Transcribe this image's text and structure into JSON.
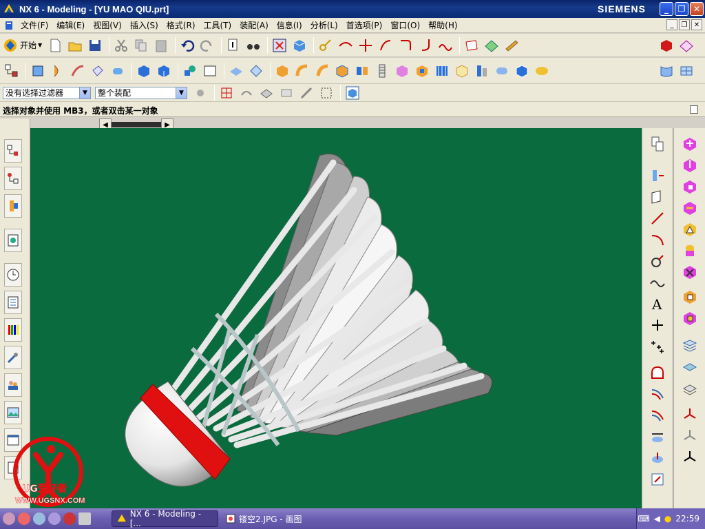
{
  "window": {
    "title": "NX 6 - Modeling - [YU MAO QIU.prt]",
    "brand": "SIEMENS"
  },
  "menu": [
    "文件(F)",
    "编辑(E)",
    "视图(V)",
    "插入(S)",
    "格式(R)",
    "工具(T)",
    "装配(A)",
    "信息(I)",
    "分析(L)",
    "首选项(P)",
    "窗口(O)",
    "帮助(H)"
  ],
  "toolbar": {
    "start_label": "开始"
  },
  "filters": {
    "selection_filter": "没有选择过滤器",
    "scope": "整个装配"
  },
  "prompt": "选择对象并使用 MB3，或者双击某一对象",
  "taskbar": {
    "apps": [
      "NX 6 - Modeling - [...",
      "镂空2.JPG - 画图"
    ],
    "clock": "22:59"
  },
  "watermark": {
    "text": "UG爱好者",
    "url": "WWW.UGSNX.COM"
  },
  "colors": {
    "viewport_bg": "#0a6b3e",
    "title_bar": "#0a246a",
    "taskbar": "#6a5fb2",
    "cork_band": "#e01010"
  }
}
